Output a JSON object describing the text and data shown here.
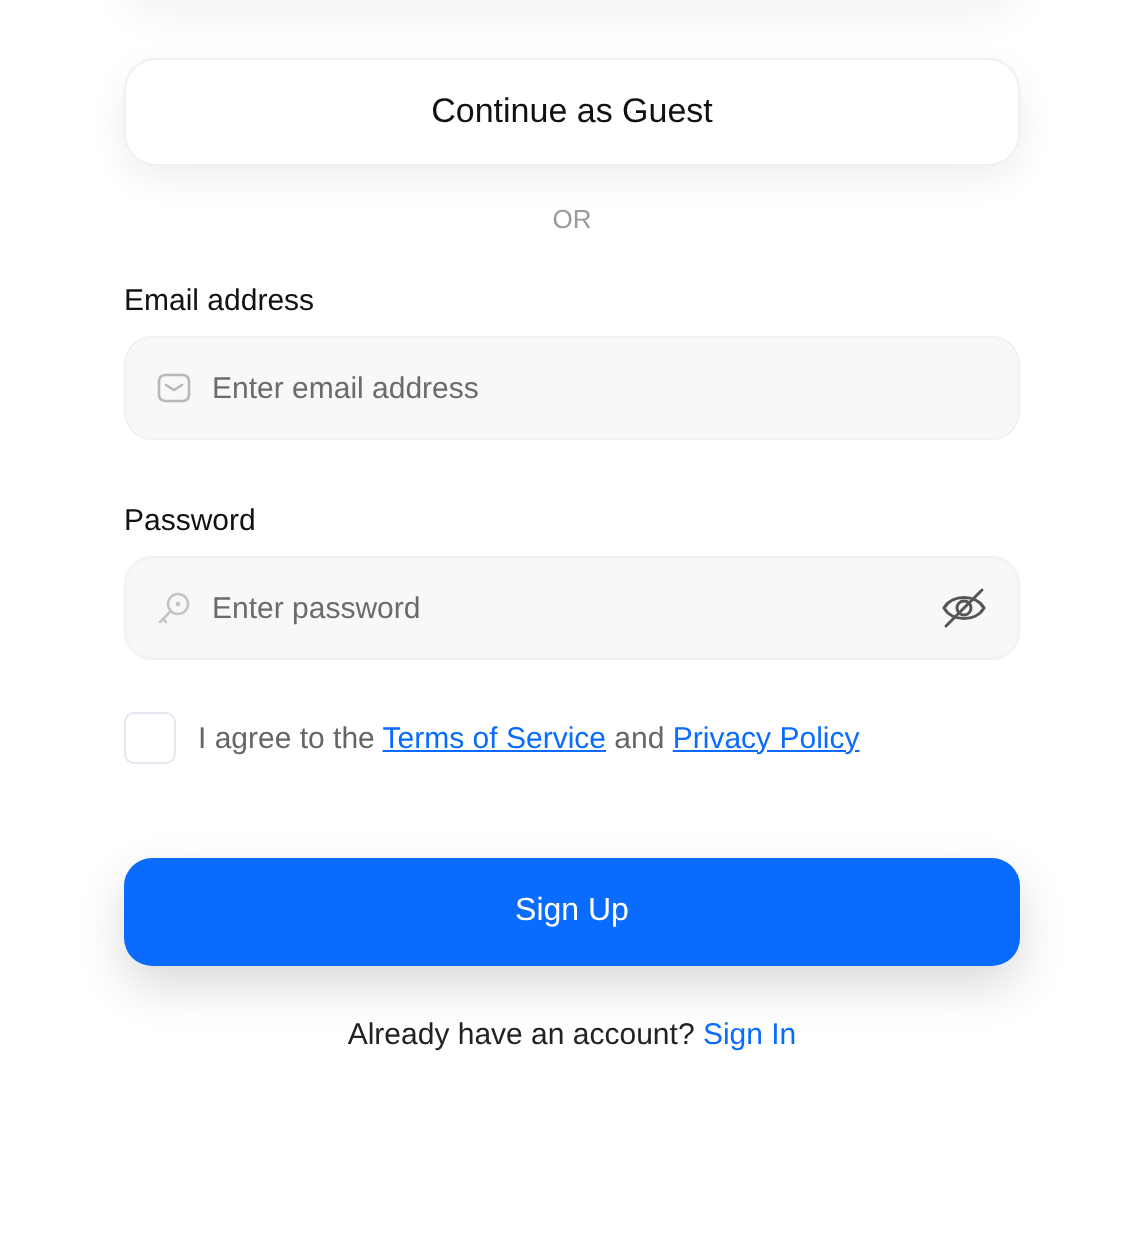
{
  "guest_button": "Continue as Guest",
  "divider": "OR",
  "fields": [
    {
      "kind": "email",
      "label": "Email address",
      "placeholder": "Enter email address"
    },
    {
      "kind": "password",
      "label": "Password",
      "placeholder": "Enter password",
      "reveal": false
    }
  ],
  "agreement": {
    "checked": false,
    "prefix": "I agree to the",
    "terms_link": "Terms of Service",
    "middle": "and",
    "privacy_link": "Privacy Policy"
  },
  "submit_button": "Sign Up",
  "footer": {
    "text": "Already have an account?",
    "link": "Sign In"
  }
}
